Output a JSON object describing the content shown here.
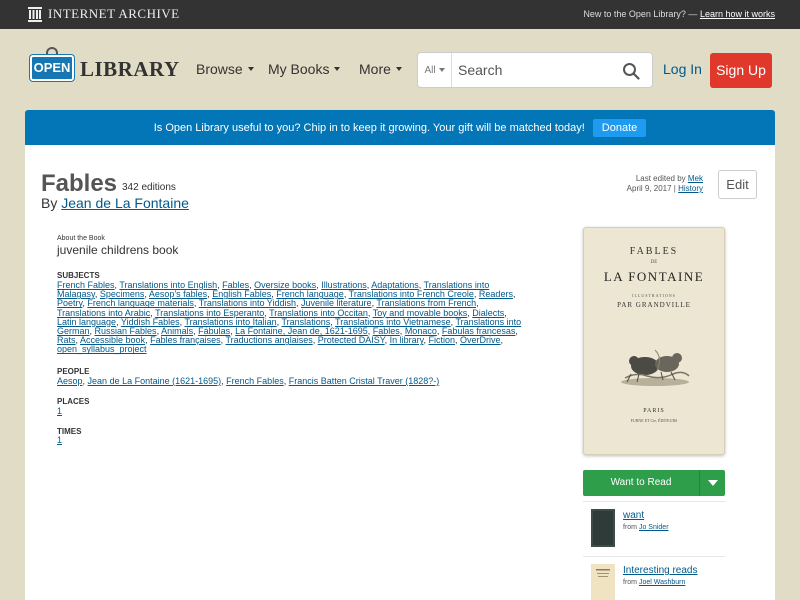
{
  "ia_bar": {
    "logo_text": "INTERNET ARCHIVE",
    "new_prompt": "New to the Open Library? —",
    "learn_link": "Learn how it works"
  },
  "header": {
    "logo_open": "OPEN",
    "logo_library": "LIBRARY",
    "nav": [
      {
        "label": "Browse"
      },
      {
        "label": "My Books"
      },
      {
        "label": "More"
      }
    ],
    "search": {
      "scope": "All",
      "placeholder": "Search"
    },
    "login": "Log In",
    "signup": "Sign Up"
  },
  "banner": {
    "text": "Is Open Library useful to you? Chip in to keep it growing. Your gift will be matched today!",
    "donate": "Donate",
    "color": "#0376b8"
  },
  "work": {
    "title": "Fables",
    "editions": "342 editions",
    "by": "By",
    "author": "Jean de La Fontaine",
    "last_edited_prefix": "Last edited by",
    "last_edited_user": "Mek",
    "last_edited_date": "April 9, 2017 |",
    "history": "History",
    "edit": "Edit",
    "about_label": "About the Book",
    "about_text": "juvenile childrens book",
    "subjects_head": "SUBJECTS",
    "subjects": [
      "French Fables",
      "Translations into English",
      "Fables",
      "Oversize books",
      "Illustrations",
      "Adaptations",
      "Translations into Malagasy",
      "Specimens",
      "Aesop's fables",
      "English Fables",
      "French language",
      "Translations into French Creole",
      "Readers",
      "Poetry",
      "French language materials",
      "Translations into Yiddish",
      "Juvenile literature",
      "Translations from French",
      "Translations into Arabic",
      "Translations into Esperanto",
      "Translations into Occitan",
      "Toy and movable books",
      "Dialects",
      "Latin language",
      "Yiddish Fables",
      "Translations into Italian",
      "Translations",
      "Translations into Vietnamese",
      "Translations into German",
      "Russian Fables",
      "Animals",
      "Fábulas",
      "La Fontaine, Jean de, 1621-1695",
      "Fables",
      "Monaco",
      "Fabulas francesas",
      "Rats",
      "Accessible book",
      "Fables françaises",
      "Traductions anglaises",
      "Protected DAISY",
      "In library",
      "Fiction",
      "OverDrive",
      "open_syllabus_project"
    ],
    "people_head": "PEOPLE",
    "people": [
      "Aesop",
      "Jean de La Fontaine (1621-1695)",
      "French Fables",
      "Francis Batten Cristal Traver (1828?-)"
    ],
    "places_head": "PLACES",
    "places": [
      "1"
    ],
    "times_head": "TIMES",
    "times": [
      "1"
    ]
  },
  "cover": {
    "line1": "FABLES",
    "line2": "DE",
    "line3": "LA FONTAINE",
    "line4": "ILLUSTRATIONS",
    "line5": "PAR GRANDVILLE",
    "line6": "PARIS",
    "line7": "FURNE ET Cie, ÉDITEURS"
  },
  "want_to_read": {
    "label": "Want to Read",
    "color": "#2f9e4b"
  },
  "lists": [
    {
      "name": "want",
      "from_prefix": "from",
      "from_user": "Jo Snider",
      "thumb": "dark-book-icon"
    },
    {
      "name": "Interesting reads",
      "from_prefix": "from",
      "from_user": "Joel Washburn",
      "thumb": "cream-book-icon"
    }
  ]
}
